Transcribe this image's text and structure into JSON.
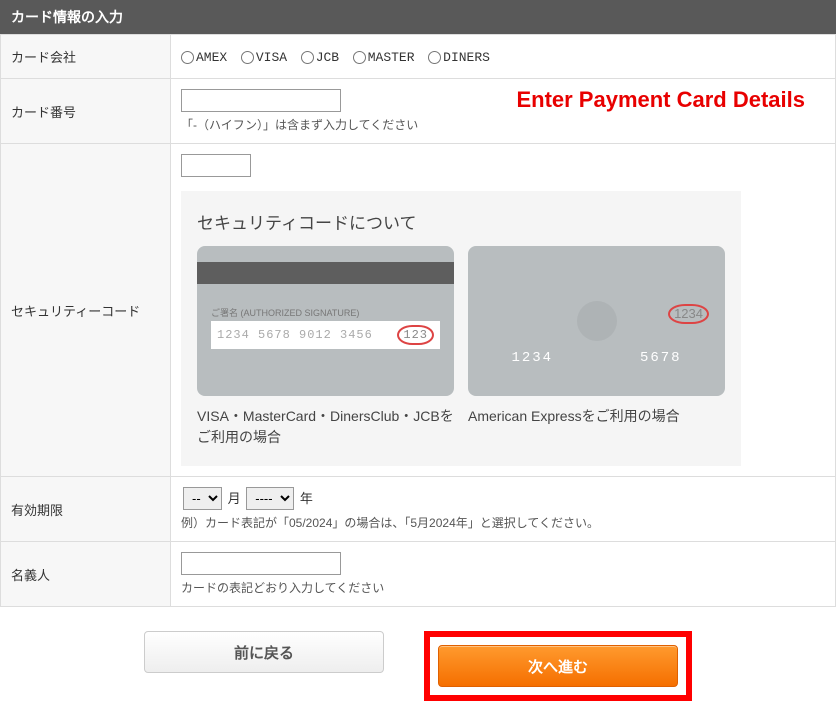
{
  "header": {
    "title": "カード情報の入力"
  },
  "rows": {
    "company": {
      "label": "カード会社",
      "options": [
        "AMEX",
        "VISA",
        "JCB",
        "MASTER",
        "DINERS"
      ]
    },
    "number": {
      "label": "カード番号",
      "value": "",
      "hint": "「-（ハイフン）」は含まず入力してください"
    },
    "security": {
      "label": "セキュリティーコード",
      "value": "",
      "box_title": "セキュリティコードについて",
      "card1": {
        "sig_label": "ご署名 (AUTHORIZED SIGNATURE)",
        "digits": "1234 5678 9012 3456",
        "cvv": "123",
        "caption": "VISA・MasterCard・DinersClub・JCBをご利用の場合"
      },
      "card2": {
        "num1": "1234",
        "num2": "5678",
        "cvv": "1234",
        "caption": "American Expressをご利用の場合"
      }
    },
    "expiry": {
      "label": "有効期限",
      "month_placeholder": "--",
      "month_suffix": "月",
      "year_placeholder": "----",
      "year_suffix": "年",
      "hint": "例）カード表記が「05/2024」の場合は、「5月2024年」と選択してください。"
    },
    "holder": {
      "label": "名義人",
      "value": "",
      "hint": "カードの表記どおり入力してください"
    }
  },
  "annotation": "Enter Payment Card Details",
  "buttons": {
    "back": "前に戻る",
    "next": "次へ進む"
  }
}
